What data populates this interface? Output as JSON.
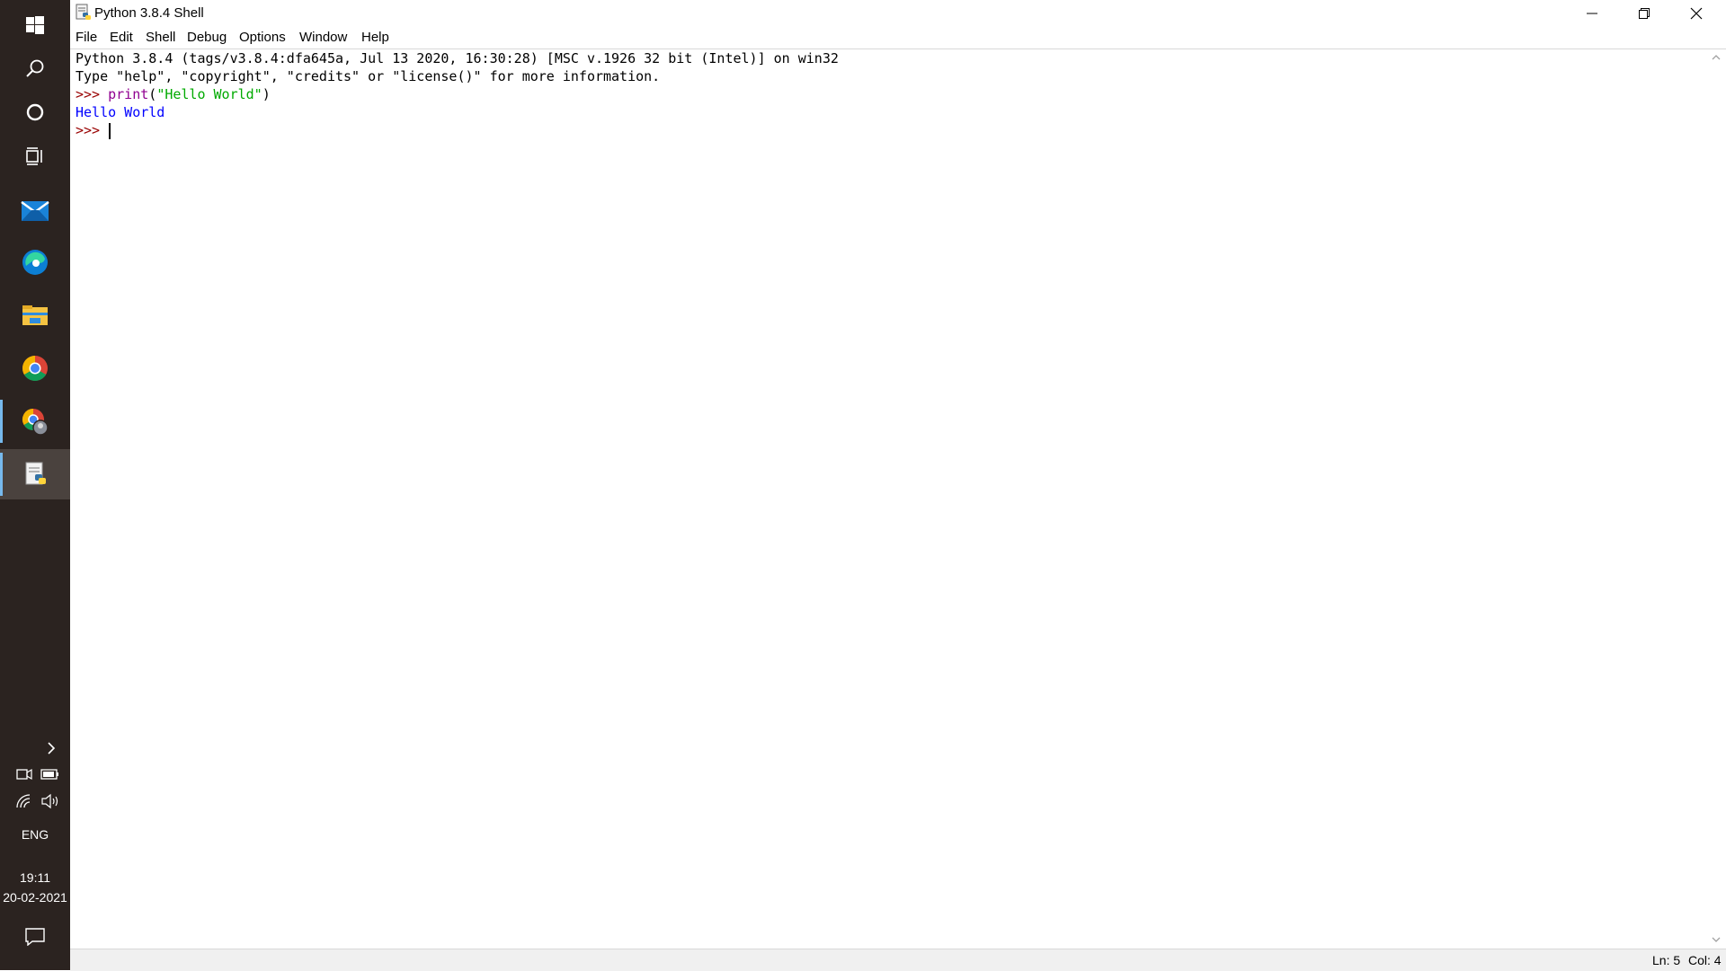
{
  "window": {
    "title": "Python 3.8.4 Shell",
    "controls": {
      "minimize": "minimize-icon",
      "maximize": "restore-icon",
      "close": "close-icon"
    }
  },
  "menu": [
    "File",
    "Edit",
    "Shell",
    "Debug",
    "Options",
    "Window",
    "Help"
  ],
  "shell": {
    "banner1": "Python 3.8.4 (tags/v3.8.4:dfa645a, Jul 13 2020, 16:30:28) [MSC v.1926 32 bit (Intel)] on win32",
    "banner2": "Type \"help\", \"copyright\", \"credits\" or \"license()\" for more information.",
    "prompt": ">>> ",
    "cmd_func": "print",
    "cmd_open": "(",
    "cmd_string": "\"Hello World\"",
    "cmd_close": ")",
    "output": "Hello World",
    "prompt2": ">>> "
  },
  "status": {
    "line": "Ln: 5",
    "col": "Col: 4"
  },
  "taskbar": {
    "apps": [
      "windows-start-icon",
      "search-icon",
      "cortana-icon",
      "task-view-icon",
      "mail-icon",
      "edge-icon",
      "file-explorer-icon",
      "chrome-icon",
      "chrome-profile-icon",
      "python-idle-icon"
    ],
    "language": "ENG",
    "time": "19:11",
    "date": "20-02-2021"
  },
  "colors": {
    "taskbar_bg": "#2b2320",
    "prompt": "#990000",
    "keyword": "#900090",
    "string": "#00aa00",
    "output": "#0000ff"
  }
}
